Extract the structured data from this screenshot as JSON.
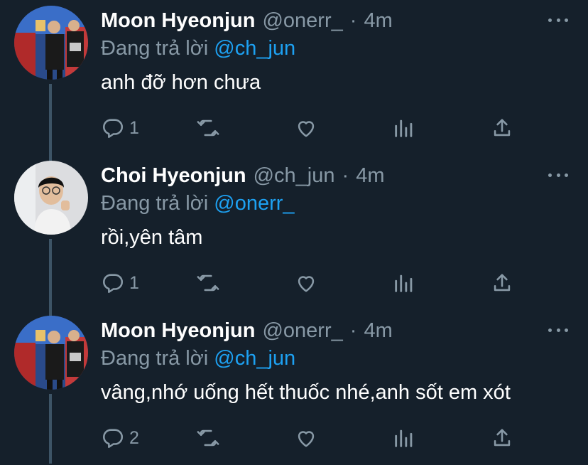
{
  "tweets": [
    {
      "name": "Moon Hyeonjun",
      "handle": "@onerr_",
      "dot": "·",
      "time": "4m",
      "reply_prefix": "Đang trả lời",
      "reply_to": "@ch_jun",
      "text": "anh đỡ hơn chưa",
      "reply_count": "1",
      "avatar_icon": "avatar-photo-icon"
    },
    {
      "name": "Choi Hyeonjun",
      "handle": "@ch_jun",
      "dot": "·",
      "time": "4m",
      "reply_prefix": "Đang trả lời",
      "reply_to": "@onerr_",
      "text": "rồi,yên tâm",
      "reply_count": "1",
      "avatar_icon": "avatar-photo-icon"
    },
    {
      "name": "Moon Hyeonjun",
      "handle": "@onerr_",
      "dot": "·",
      "time": "4m",
      "reply_prefix": "Đang trả lời",
      "reply_to": "@ch_jun",
      "text": "vâng,nhớ uống hết thuốc nhé,anh sốt em xót",
      "reply_count": "2",
      "avatar_icon": "avatar-photo-icon"
    }
  ],
  "colors": {
    "background": "#15202b",
    "muted": "#8899a6",
    "link": "#1da1f2",
    "thread_line": "#3d5466"
  },
  "icons": [
    "reply-icon",
    "retweet-icon",
    "like-icon",
    "analytics-icon",
    "share-icon",
    "more-icon"
  ]
}
